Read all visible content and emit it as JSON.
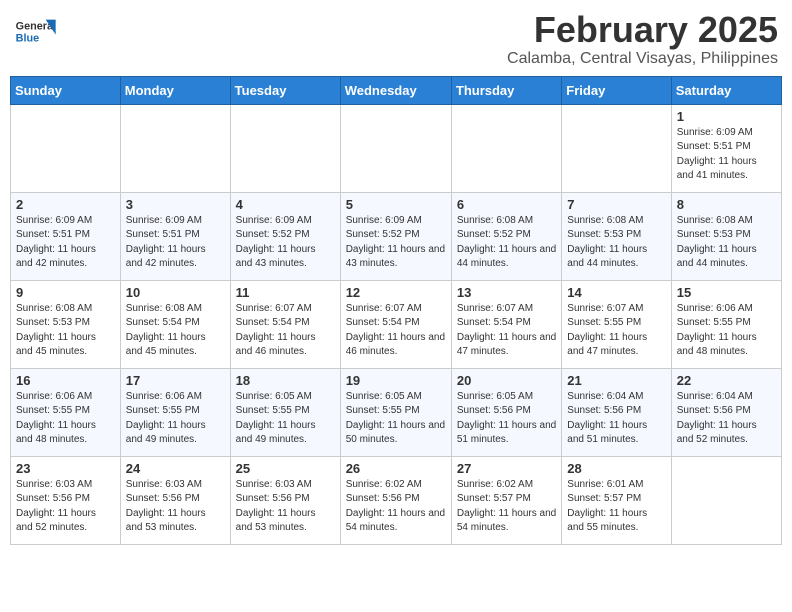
{
  "header": {
    "logo_line1": "General",
    "logo_line2": "Blue",
    "month": "February 2025",
    "location": "Calamba, Central Visayas, Philippines"
  },
  "weekdays": [
    "Sunday",
    "Monday",
    "Tuesday",
    "Wednesday",
    "Thursday",
    "Friday",
    "Saturday"
  ],
  "weeks": [
    [
      {
        "day": "",
        "info": ""
      },
      {
        "day": "",
        "info": ""
      },
      {
        "day": "",
        "info": ""
      },
      {
        "day": "",
        "info": ""
      },
      {
        "day": "",
        "info": ""
      },
      {
        "day": "",
        "info": ""
      },
      {
        "day": "1",
        "info": "Sunrise: 6:09 AM\nSunset: 5:51 PM\nDaylight: 11 hours\nand 41 minutes."
      }
    ],
    [
      {
        "day": "2",
        "info": "Sunrise: 6:09 AM\nSunset: 5:51 PM\nDaylight: 11 hours\nand 42 minutes."
      },
      {
        "day": "3",
        "info": "Sunrise: 6:09 AM\nSunset: 5:51 PM\nDaylight: 11 hours\nand 42 minutes."
      },
      {
        "day": "4",
        "info": "Sunrise: 6:09 AM\nSunset: 5:52 PM\nDaylight: 11 hours\nand 43 minutes."
      },
      {
        "day": "5",
        "info": "Sunrise: 6:09 AM\nSunset: 5:52 PM\nDaylight: 11 hours\nand 43 minutes."
      },
      {
        "day": "6",
        "info": "Sunrise: 6:08 AM\nSunset: 5:52 PM\nDaylight: 11 hours\nand 44 minutes."
      },
      {
        "day": "7",
        "info": "Sunrise: 6:08 AM\nSunset: 5:53 PM\nDaylight: 11 hours\nand 44 minutes."
      },
      {
        "day": "8",
        "info": "Sunrise: 6:08 AM\nSunset: 5:53 PM\nDaylight: 11 hours\nand 44 minutes."
      }
    ],
    [
      {
        "day": "9",
        "info": "Sunrise: 6:08 AM\nSunset: 5:53 PM\nDaylight: 11 hours\nand 45 minutes."
      },
      {
        "day": "10",
        "info": "Sunrise: 6:08 AM\nSunset: 5:54 PM\nDaylight: 11 hours\nand 45 minutes."
      },
      {
        "day": "11",
        "info": "Sunrise: 6:07 AM\nSunset: 5:54 PM\nDaylight: 11 hours\nand 46 minutes."
      },
      {
        "day": "12",
        "info": "Sunrise: 6:07 AM\nSunset: 5:54 PM\nDaylight: 11 hours\nand 46 minutes."
      },
      {
        "day": "13",
        "info": "Sunrise: 6:07 AM\nSunset: 5:54 PM\nDaylight: 11 hours\nand 47 minutes."
      },
      {
        "day": "14",
        "info": "Sunrise: 6:07 AM\nSunset: 5:55 PM\nDaylight: 11 hours\nand 47 minutes."
      },
      {
        "day": "15",
        "info": "Sunrise: 6:06 AM\nSunset: 5:55 PM\nDaylight: 11 hours\nand 48 minutes."
      }
    ],
    [
      {
        "day": "16",
        "info": "Sunrise: 6:06 AM\nSunset: 5:55 PM\nDaylight: 11 hours\nand 48 minutes."
      },
      {
        "day": "17",
        "info": "Sunrise: 6:06 AM\nSunset: 5:55 PM\nDaylight: 11 hours\nand 49 minutes."
      },
      {
        "day": "18",
        "info": "Sunrise: 6:05 AM\nSunset: 5:55 PM\nDaylight: 11 hours\nand 49 minutes."
      },
      {
        "day": "19",
        "info": "Sunrise: 6:05 AM\nSunset: 5:55 PM\nDaylight: 11 hours\nand 50 minutes."
      },
      {
        "day": "20",
        "info": "Sunrise: 6:05 AM\nSunset: 5:56 PM\nDaylight: 11 hours\nand 51 minutes."
      },
      {
        "day": "21",
        "info": "Sunrise: 6:04 AM\nSunset: 5:56 PM\nDaylight: 11 hours\nand 51 minutes."
      },
      {
        "day": "22",
        "info": "Sunrise: 6:04 AM\nSunset: 5:56 PM\nDaylight: 11 hours\nand 52 minutes."
      }
    ],
    [
      {
        "day": "23",
        "info": "Sunrise: 6:03 AM\nSunset: 5:56 PM\nDaylight: 11 hours\nand 52 minutes."
      },
      {
        "day": "24",
        "info": "Sunrise: 6:03 AM\nSunset: 5:56 PM\nDaylight: 11 hours\nand 53 minutes."
      },
      {
        "day": "25",
        "info": "Sunrise: 6:03 AM\nSunset: 5:56 PM\nDaylight: 11 hours\nand 53 minutes."
      },
      {
        "day": "26",
        "info": "Sunrise: 6:02 AM\nSunset: 5:56 PM\nDaylight: 11 hours\nand 54 minutes."
      },
      {
        "day": "27",
        "info": "Sunrise: 6:02 AM\nSunset: 5:57 PM\nDaylight: 11 hours\nand 54 minutes."
      },
      {
        "day": "28",
        "info": "Sunrise: 6:01 AM\nSunset: 5:57 PM\nDaylight: 11 hours\nand 55 minutes."
      },
      {
        "day": "",
        "info": ""
      }
    ]
  ]
}
